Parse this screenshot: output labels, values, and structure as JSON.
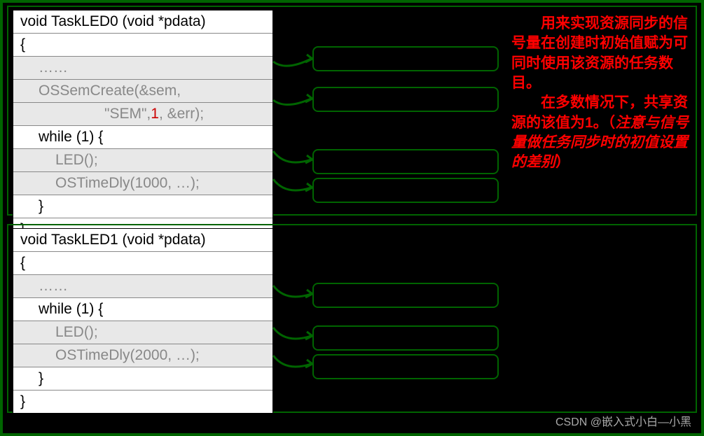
{
  "code0": {
    "line1": "void  TaskLED0 (void  *pdata)",
    "line2": "{",
    "line3": "……",
    "line4a": "OSSemCreate(&sem,",
    "line4b_pre": "\"SEM\", ",
    "line4b_num": "1",
    "line4b_post": ", &err);",
    "line5": "while (1) {",
    "line6": "LED();",
    "line7": "OSTimeDly(1000, …);",
    "line8": "}",
    "line9": "}"
  },
  "code1": {
    "line1": "void  TaskLED1 (void  *pdata)",
    "line2": "{",
    "line3": "……",
    "line4": "while (1) {",
    "line5": "LED();",
    "line6": "OSTimeDly(2000, …);",
    "line7": "}",
    "line8": "}"
  },
  "annotation": {
    "p1": "　　用来实现资源同步的信号量在创建时初始值赋为可同时使用该资源的任务数目。",
    "p2_a": "　　在多数情况下，共享资源的该值为1。（",
    "p2_b": "注意与信号量做任务同步时的初值设置的差别",
    "p2_c": "）"
  },
  "watermark": "CSDN @嵌入式小白—小黑"
}
